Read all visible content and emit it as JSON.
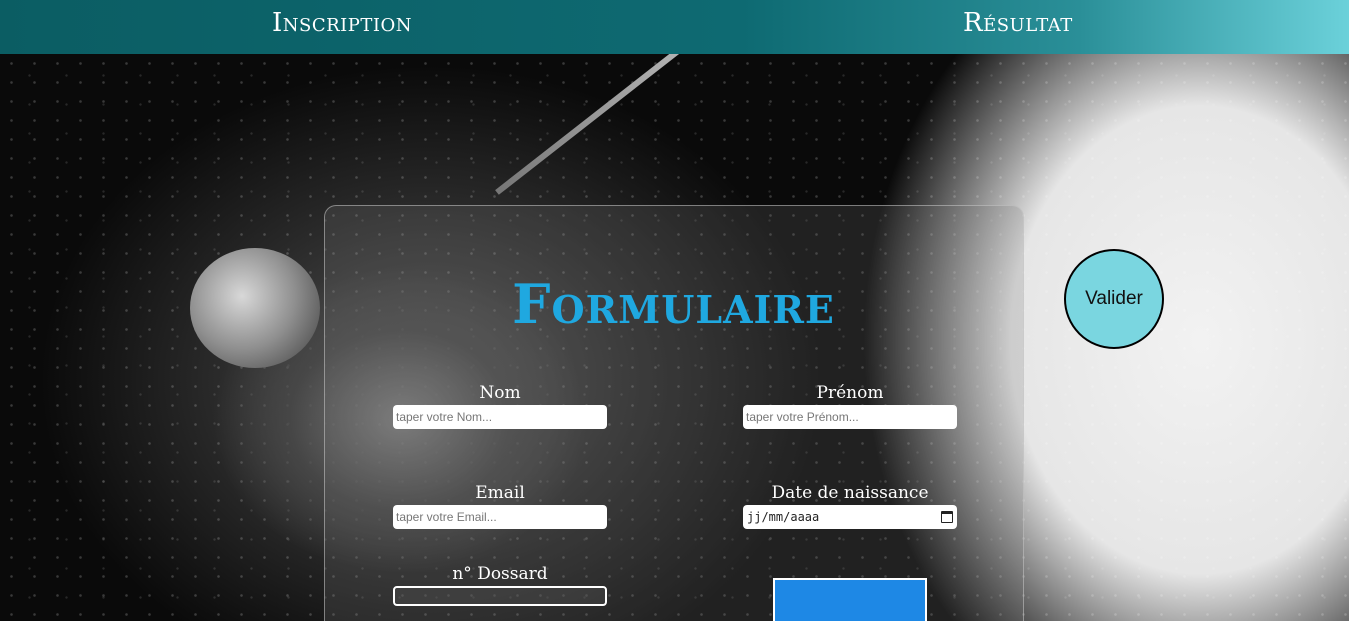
{
  "nav": {
    "inscription": "Inscription",
    "resultat": "Résultat"
  },
  "form": {
    "title": "Formulaire",
    "fields": {
      "nom": {
        "label": "Nom",
        "placeholder": "taper votre Nom..."
      },
      "prenom": {
        "label": "Prénom",
        "placeholder": "taper votre Prénom..."
      },
      "email": {
        "label": "Email",
        "placeholder": "taper votre Email..."
      },
      "date_naissance": {
        "label": "Date de naissance",
        "value": "jj/mm/aaaa"
      },
      "dossard": {
        "label": "n° Dossard",
        "value": ""
      }
    },
    "submit_label": "Valider"
  },
  "colors": {
    "header": "#0e6a72",
    "title": "#1fa8e0",
    "valider_bg": "#7ad6e0",
    "blue_block": "#1e88e5"
  },
  "icons": {
    "calendar": "calendar-icon"
  }
}
